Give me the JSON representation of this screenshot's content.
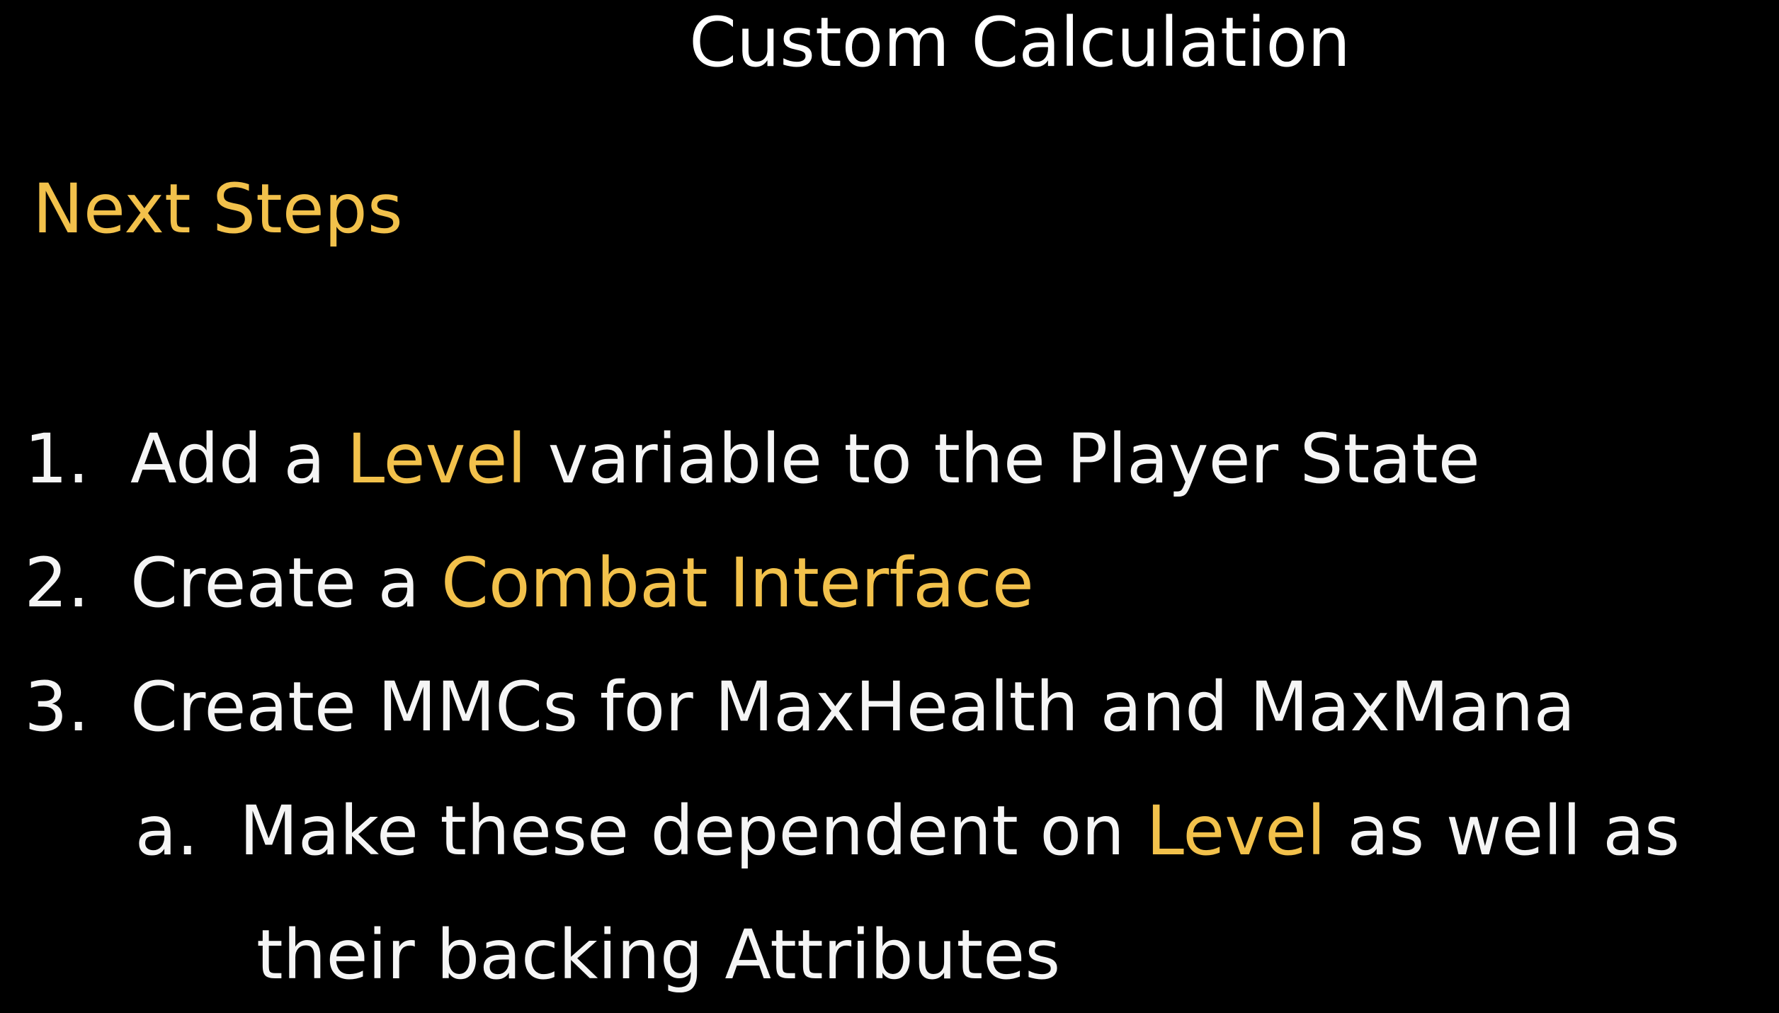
{
  "slide": {
    "title": "Custom Calculation",
    "subtitle": "Next Steps",
    "steps": [
      {
        "number": "1.",
        "parts": [
          "Add a ",
          "Level",
          " variable to the Player State"
        ]
      },
      {
        "number": "2.",
        "parts": [
          "Create a ",
          "Combat Interface"
        ]
      },
      {
        "number": "3.",
        "parts": [
          "Create MMCs for MaxHealth and MaxMana"
        ]
      }
    ],
    "substeps": [
      {
        "letter": "a.",
        "parts": [
          "Make these dependent on ",
          "Level",
          " as well as"
        ],
        "continuation": "their backing Attributes"
      }
    ]
  },
  "colors": {
    "background": "#000000",
    "text": "#f5f5f5",
    "highlight": "#f2c14b"
  }
}
